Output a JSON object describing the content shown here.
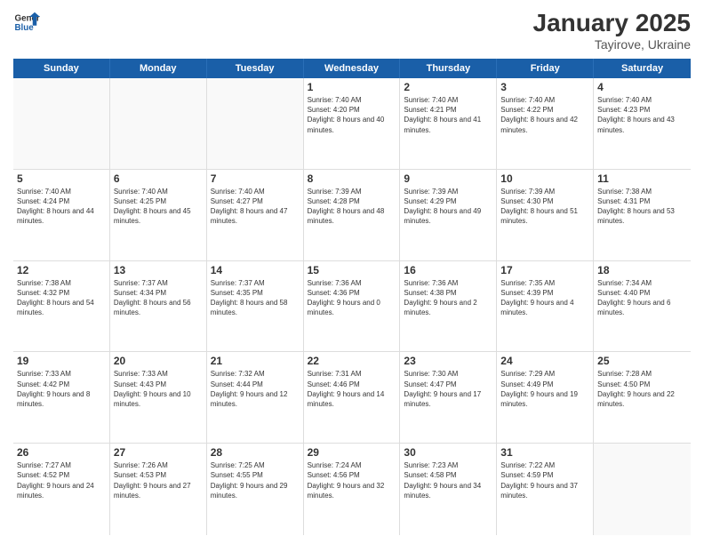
{
  "header": {
    "logo": {
      "general": "General",
      "blue": "Blue"
    },
    "title": "January 2025",
    "location": "Tayirove, Ukraine"
  },
  "weekdays": [
    "Sunday",
    "Monday",
    "Tuesday",
    "Wednesday",
    "Thursday",
    "Friday",
    "Saturday"
  ],
  "weeks": [
    [
      {
        "day": "",
        "empty": true
      },
      {
        "day": "",
        "empty": true
      },
      {
        "day": "",
        "empty": true
      },
      {
        "day": "1",
        "sunrise": "7:40 AM",
        "sunset": "4:20 PM",
        "daylight": "8 hours and 40 minutes."
      },
      {
        "day": "2",
        "sunrise": "7:40 AM",
        "sunset": "4:21 PM",
        "daylight": "8 hours and 41 minutes."
      },
      {
        "day": "3",
        "sunrise": "7:40 AM",
        "sunset": "4:22 PM",
        "daylight": "8 hours and 42 minutes."
      },
      {
        "day": "4",
        "sunrise": "7:40 AM",
        "sunset": "4:23 PM",
        "daylight": "8 hours and 43 minutes."
      }
    ],
    [
      {
        "day": "5",
        "sunrise": "7:40 AM",
        "sunset": "4:24 PM",
        "daylight": "8 hours and 44 minutes."
      },
      {
        "day": "6",
        "sunrise": "7:40 AM",
        "sunset": "4:25 PM",
        "daylight": "8 hours and 45 minutes."
      },
      {
        "day": "7",
        "sunrise": "7:40 AM",
        "sunset": "4:27 PM",
        "daylight": "8 hours and 47 minutes."
      },
      {
        "day": "8",
        "sunrise": "7:39 AM",
        "sunset": "4:28 PM",
        "daylight": "8 hours and 48 minutes."
      },
      {
        "day": "9",
        "sunrise": "7:39 AM",
        "sunset": "4:29 PM",
        "daylight": "8 hours and 49 minutes."
      },
      {
        "day": "10",
        "sunrise": "7:39 AM",
        "sunset": "4:30 PM",
        "daylight": "8 hours and 51 minutes."
      },
      {
        "day": "11",
        "sunrise": "7:38 AM",
        "sunset": "4:31 PM",
        "daylight": "8 hours and 53 minutes."
      }
    ],
    [
      {
        "day": "12",
        "sunrise": "7:38 AM",
        "sunset": "4:32 PM",
        "daylight": "8 hours and 54 minutes."
      },
      {
        "day": "13",
        "sunrise": "7:37 AM",
        "sunset": "4:34 PM",
        "daylight": "8 hours and 56 minutes."
      },
      {
        "day": "14",
        "sunrise": "7:37 AM",
        "sunset": "4:35 PM",
        "daylight": "8 hours and 58 minutes."
      },
      {
        "day": "15",
        "sunrise": "7:36 AM",
        "sunset": "4:36 PM",
        "daylight": "9 hours and 0 minutes."
      },
      {
        "day": "16",
        "sunrise": "7:36 AM",
        "sunset": "4:38 PM",
        "daylight": "9 hours and 2 minutes."
      },
      {
        "day": "17",
        "sunrise": "7:35 AM",
        "sunset": "4:39 PM",
        "daylight": "9 hours and 4 minutes."
      },
      {
        "day": "18",
        "sunrise": "7:34 AM",
        "sunset": "4:40 PM",
        "daylight": "9 hours and 6 minutes."
      }
    ],
    [
      {
        "day": "19",
        "sunrise": "7:33 AM",
        "sunset": "4:42 PM",
        "daylight": "9 hours and 8 minutes."
      },
      {
        "day": "20",
        "sunrise": "7:33 AM",
        "sunset": "4:43 PM",
        "daylight": "9 hours and 10 minutes."
      },
      {
        "day": "21",
        "sunrise": "7:32 AM",
        "sunset": "4:44 PM",
        "daylight": "9 hours and 12 minutes."
      },
      {
        "day": "22",
        "sunrise": "7:31 AM",
        "sunset": "4:46 PM",
        "daylight": "9 hours and 14 minutes."
      },
      {
        "day": "23",
        "sunrise": "7:30 AM",
        "sunset": "4:47 PM",
        "daylight": "9 hours and 17 minutes."
      },
      {
        "day": "24",
        "sunrise": "7:29 AM",
        "sunset": "4:49 PM",
        "daylight": "9 hours and 19 minutes."
      },
      {
        "day": "25",
        "sunrise": "7:28 AM",
        "sunset": "4:50 PM",
        "daylight": "9 hours and 22 minutes."
      }
    ],
    [
      {
        "day": "26",
        "sunrise": "7:27 AM",
        "sunset": "4:52 PM",
        "daylight": "9 hours and 24 minutes."
      },
      {
        "day": "27",
        "sunrise": "7:26 AM",
        "sunset": "4:53 PM",
        "daylight": "9 hours and 27 minutes."
      },
      {
        "day": "28",
        "sunrise": "7:25 AM",
        "sunset": "4:55 PM",
        "daylight": "9 hours and 29 minutes."
      },
      {
        "day": "29",
        "sunrise": "7:24 AM",
        "sunset": "4:56 PM",
        "daylight": "9 hours and 32 minutes."
      },
      {
        "day": "30",
        "sunrise": "7:23 AM",
        "sunset": "4:58 PM",
        "daylight": "9 hours and 34 minutes."
      },
      {
        "day": "31",
        "sunrise": "7:22 AM",
        "sunset": "4:59 PM",
        "daylight": "9 hours and 37 minutes."
      },
      {
        "day": "",
        "empty": true
      }
    ]
  ]
}
